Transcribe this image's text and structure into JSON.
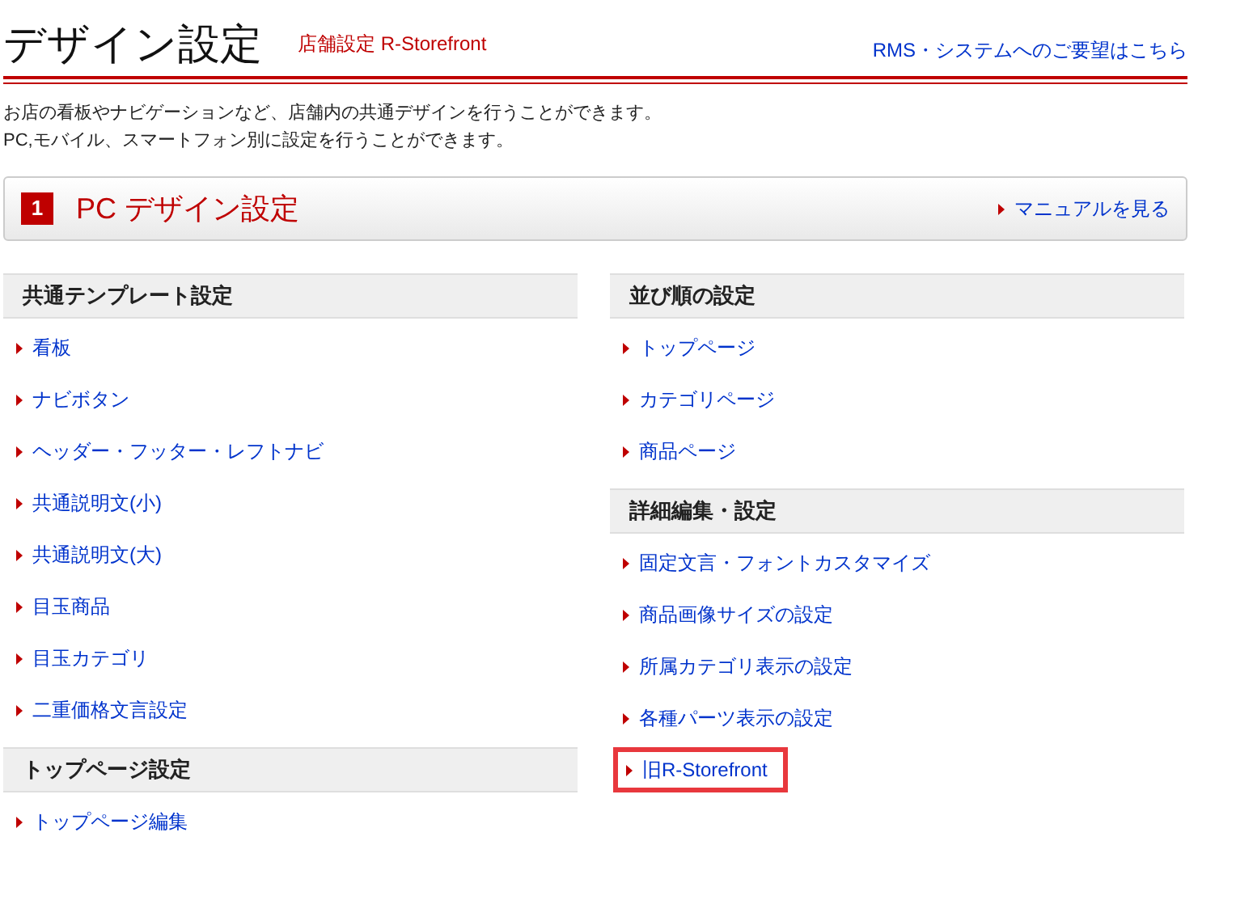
{
  "header": {
    "title": "デザイン設定",
    "subtitle": "店舗設定 R-Storefront",
    "feedback_link": "RMS・システムへのご要望はこちら"
  },
  "description": [
    "お店の看板やナビゲーションなど、店舗内の共通デザインを行うことができます。",
    "PC,モバイル、スマートフォン別に設定を行うことができます。"
  ],
  "section_bar": {
    "number": "1",
    "title": "PC デザイン設定",
    "manual_link": "マニュアルを見る"
  },
  "columns": [
    {
      "sections": [
        {
          "heading": "共通テンプレート設定",
          "links": [
            {
              "label": "看板",
              "highlighted": false
            },
            {
              "label": "ナビボタン",
              "highlighted": false
            },
            {
              "label": "ヘッダー・フッター・レフトナビ",
              "highlighted": false
            },
            {
              "label": "共通説明文(小)",
              "highlighted": false
            },
            {
              "label": "共通説明文(大)",
              "highlighted": false
            },
            {
              "label": "目玉商品",
              "highlighted": false
            },
            {
              "label": "目玉カテゴリ",
              "highlighted": false
            },
            {
              "label": "二重価格文言設定",
              "highlighted": false
            }
          ]
        },
        {
          "heading": "トップページ設定",
          "links": [
            {
              "label": "トップページ編集",
              "highlighted": false
            }
          ]
        }
      ]
    },
    {
      "sections": [
        {
          "heading": "並び順の設定",
          "links": [
            {
              "label": "トップページ",
              "highlighted": false
            },
            {
              "label": "カテゴリページ",
              "highlighted": false
            },
            {
              "label": "商品ページ",
              "highlighted": false
            }
          ]
        },
        {
          "heading": "詳細編集・設定",
          "links": [
            {
              "label": "固定文言・フォントカスタマイズ",
              "highlighted": false
            },
            {
              "label": "商品画像サイズの設定",
              "highlighted": false
            },
            {
              "label": "所属カテゴリ表示の設定",
              "highlighted": false
            },
            {
              "label": "各種パーツ表示の設定",
              "highlighted": false
            },
            {
              "label": "旧R-Storefront",
              "highlighted": true
            }
          ]
        }
      ]
    }
  ]
}
